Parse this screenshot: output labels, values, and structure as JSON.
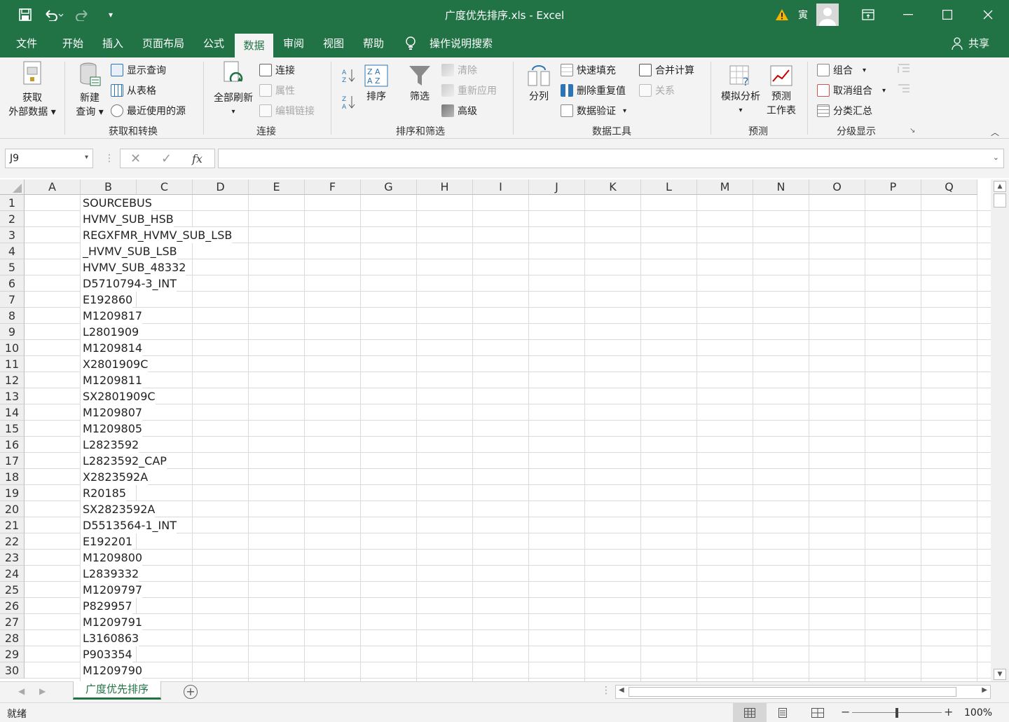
{
  "window": {
    "title": "广度优先排序.xls",
    "app_sep": " - ",
    "app": "Excel",
    "user_initial": "寅",
    "share_label": "共享"
  },
  "tabs": [
    "文件",
    "开始",
    "插入",
    "页面布局",
    "公式",
    "数据",
    "审阅",
    "视图",
    "帮助"
  ],
  "active_tab": "数据",
  "tell_me": "操作说明搜索",
  "ribbon": {
    "get_external_data": [
      "获取",
      "外部数据"
    ],
    "new_query": [
      "新建",
      "查询"
    ],
    "show_queries": "显示查询",
    "from_table": "从表格",
    "recent_sources": "最近使用的源",
    "group_get_transform": "获取和转换",
    "refresh_all": "全部刷新",
    "connections": "连接",
    "properties": "属性",
    "edit_links": "编辑链接",
    "group_connections": "连接",
    "sort": "排序",
    "filter": "筛选",
    "clear": "清除",
    "reapply": "重新应用",
    "advanced": "高级",
    "group_sort_filter": "排序和筛选",
    "text_to_columns": "分列",
    "flash_fill": "快速填充",
    "remove_duplicates": "删除重复值",
    "data_validation": "数据验证",
    "consolidate": "合并计算",
    "relationships": "关系",
    "group_data_tools": "数据工具",
    "what_if": "模拟分析",
    "forecast_sheet": [
      "预测",
      "工作表"
    ],
    "group_forecast": "预测",
    "group_btn": "组合",
    "ungroup": "取消组合",
    "subtotal": "分类汇总",
    "group_outline": "分级显示"
  },
  "formula_bar": {
    "name_box": "J9",
    "fx": "fx",
    "formula": ""
  },
  "columns": [
    "A",
    "B",
    "C",
    "D",
    "E",
    "F",
    "G",
    "H",
    "I",
    "J",
    "K",
    "L",
    "M",
    "N",
    "O",
    "P",
    "Q"
  ],
  "rows": [
    "1",
    "2",
    "3",
    "4",
    "5",
    "6",
    "7",
    "8",
    "9",
    "10",
    "11",
    "12",
    "13",
    "14",
    "15",
    "16",
    "17",
    "18",
    "19",
    "20",
    "21",
    "22",
    "23",
    "24",
    "25",
    "26",
    "27",
    "28",
    "29",
    "30"
  ],
  "column_b_values": [
    "SOURCEBUS",
    "HVMV_SUB_HSB",
    "REGXFMR_HVMV_SUB_LSB",
    "_HVMV_SUB_LSB",
    "HVMV_SUB_48332",
    "D5710794-3_INT",
    "E192860",
    "M1209817",
    "L2801909",
    "M1209814",
    "X2801909C",
    "M1209811",
    "SX2801909C",
    "M1209807",
    "M1209805",
    "L2823592",
    "L2823592_CAP",
    "X2823592A",
    "R20185",
    "SX2823592A",
    "D5513564-1_INT",
    "E192201",
    "M1209800",
    "L2839332",
    "M1209797",
    "P829957",
    "M1209791",
    "L3160863",
    "P903354",
    "M1209790"
  ],
  "sheet_tab": "广度优先排序",
  "status": {
    "ready": "就绪",
    "zoom": "100%"
  },
  "colors": {
    "accent": "#217346"
  }
}
